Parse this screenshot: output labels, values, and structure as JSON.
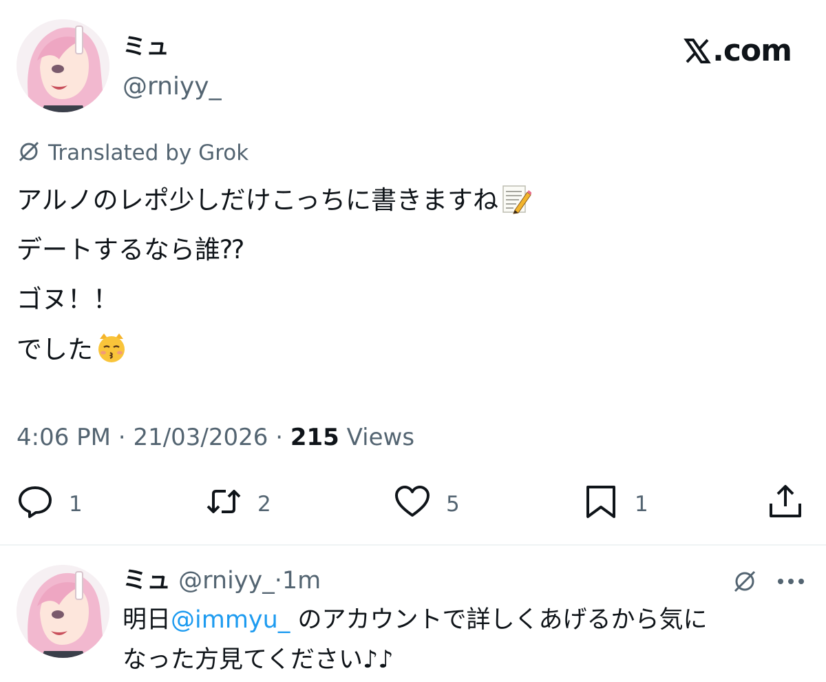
{
  "main_tweet": {
    "author_name": "ミュ",
    "author_handle": "@rniyy_",
    "brand": ".com",
    "translated_label": "Translated by Grok",
    "body_lines": [
      "アルノのレポ少しだけこっちに書きますね",
      "デートするなら誰⁇",
      "ゴヌ！！",
      "でした"
    ],
    "emojis": [
      "memo-icon",
      "kissing-cat-icon"
    ],
    "time": "4:06 PM",
    "date": "21/03/2026",
    "views_count": "215",
    "views_label": "Views",
    "separator": " · ",
    "actions": {
      "replies": "1",
      "reposts": "2",
      "likes": "5",
      "bookmarks": "1"
    }
  },
  "reply_tweet": {
    "author_name": "ミュ",
    "author_handle": "@rniyy_",
    "time_sep": "·",
    "time": "1m",
    "body_line1_prefix": "明日",
    "mention": "@immyu_",
    "body_line1_suffix": " のアカウントで詳しくあげるから気に",
    "body_line2": "なった方見てください",
    "trailing_emoji": "♪♪"
  },
  "colors": {
    "text": "#0f1419",
    "secondary": "#536471",
    "mention": "#1d9bf0",
    "divider": "#eff3f4"
  }
}
